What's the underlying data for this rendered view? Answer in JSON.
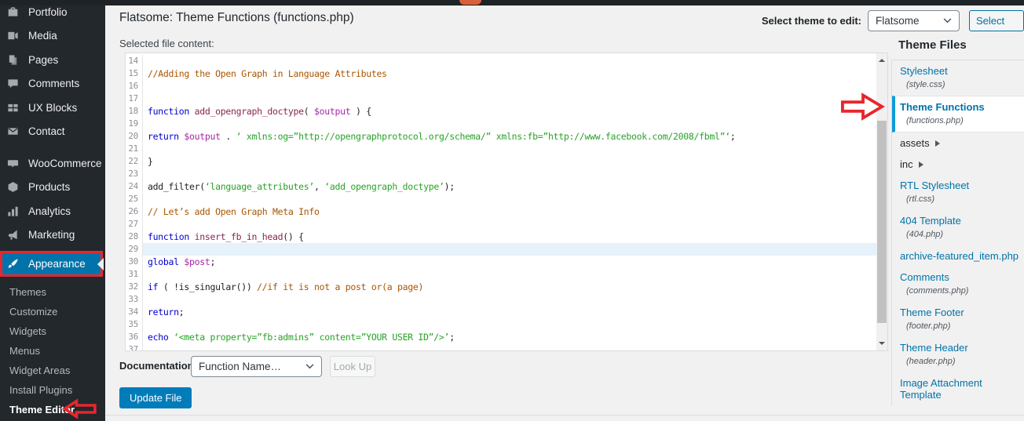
{
  "admin_bar": {
    "badge_color": "#d8613c"
  },
  "sidebar": {
    "items": [
      {
        "label": "Portfolio",
        "icon": "portfolio-icon"
      },
      {
        "label": "Media",
        "icon": "media-icon"
      },
      {
        "label": "Pages",
        "icon": "pages-icon"
      },
      {
        "label": "Comments",
        "icon": "comments-icon"
      },
      {
        "label": "UX Blocks",
        "icon": "ux-blocks-icon"
      },
      {
        "label": "Contact",
        "icon": "contact-icon",
        "separator_after": true
      },
      {
        "label": "WooCommerce",
        "icon": "woocommerce-icon"
      },
      {
        "label": "Products",
        "icon": "products-icon"
      },
      {
        "label": "Analytics",
        "icon": "analytics-icon"
      },
      {
        "label": "Marketing",
        "icon": "marketing-icon"
      }
    ],
    "appearance": {
      "label": "Appearance",
      "icon": "appearance-icon",
      "active": true,
      "annotated": true
    },
    "submenu": [
      {
        "label": "Themes"
      },
      {
        "label": "Customize"
      },
      {
        "label": "Widgets"
      },
      {
        "label": "Menus"
      },
      {
        "label": "Widget Areas"
      },
      {
        "label": "Install Plugins"
      },
      {
        "label": "Theme Editor",
        "active": true,
        "annotated": true
      }
    ]
  },
  "header": {
    "title": "Flatsome: Theme Functions (functions.php)",
    "select_theme_label": "Select theme to edit:",
    "theme_select_value": "Flatsome",
    "select_button_label": "Select"
  },
  "editor": {
    "label": "Selected file content:",
    "active_line": 29,
    "lines": [
      {
        "n": 14,
        "seg": []
      },
      {
        "n": 15,
        "seg": [
          [
            "com",
            "//Adding the Open Graph in Language Attributes"
          ]
        ]
      },
      {
        "n": 16,
        "seg": []
      },
      {
        "n": 17,
        "seg": []
      },
      {
        "n": 18,
        "seg": [
          [
            "kw",
            "function"
          ],
          [
            "pl",
            " "
          ],
          [
            "def",
            "add_opengraph_doctype"
          ],
          [
            "pl",
            "( "
          ],
          [
            "var",
            "$output"
          ],
          [
            "pl",
            " ) {"
          ]
        ]
      },
      {
        "n": 19,
        "seg": []
      },
      {
        "n": 20,
        "seg": [
          [
            "kw",
            "return"
          ],
          [
            "pl",
            " "
          ],
          [
            "var",
            "$output"
          ],
          [
            "pl",
            " . "
          ],
          [
            "str",
            "‘ xmlns:og=”http://opengraphprotocol.org/schema/” xmlns:fb=”http://www.facebook.com/2008/fbml”‘"
          ],
          [
            "pl",
            ";"
          ]
        ]
      },
      {
        "n": 21,
        "seg": []
      },
      {
        "n": 22,
        "seg": [
          [
            "pl",
            "}"
          ]
        ]
      },
      {
        "n": 23,
        "seg": []
      },
      {
        "n": 24,
        "seg": [
          [
            "pl",
            "add_filter("
          ],
          [
            "str",
            "‘language_attributes’"
          ],
          [
            "pl",
            ", "
          ],
          [
            "str",
            "‘add_opengraph_doctype’"
          ],
          [
            "pl",
            ");"
          ]
        ]
      },
      {
        "n": 25,
        "seg": []
      },
      {
        "n": 26,
        "seg": [
          [
            "com",
            "// Let’s add Open Graph Meta Info"
          ]
        ]
      },
      {
        "n": 27,
        "seg": []
      },
      {
        "n": 28,
        "seg": [
          [
            "kw",
            "function"
          ],
          [
            "pl",
            " "
          ],
          [
            "def",
            "insert_fb_in_head"
          ],
          [
            "pl",
            "() {"
          ]
        ]
      },
      {
        "n": 29,
        "seg": []
      },
      {
        "n": 30,
        "seg": [
          [
            "kw",
            "global"
          ],
          [
            "pl",
            " "
          ],
          [
            "var",
            "$post"
          ],
          [
            "pl",
            ";"
          ]
        ]
      },
      {
        "n": 31,
        "seg": []
      },
      {
        "n": 32,
        "seg": [
          [
            "kw",
            "if"
          ],
          [
            "pl",
            " ( !is_singular()) "
          ],
          [
            "com",
            "//if it is not a post or(a page)"
          ]
        ]
      },
      {
        "n": 33,
        "seg": []
      },
      {
        "n": 34,
        "seg": [
          [
            "kw",
            "return"
          ],
          [
            "pl",
            ";"
          ]
        ]
      },
      {
        "n": 35,
        "seg": []
      },
      {
        "n": 36,
        "seg": [
          [
            "kw",
            "echo"
          ],
          [
            "pl",
            " "
          ],
          [
            "str",
            "‘<meta property=”fb:admins” content=”YOUR USER ID”/>’"
          ],
          [
            "pl",
            ";"
          ]
        ]
      },
      {
        "n": 37,
        "seg": []
      }
    ]
  },
  "theme_files": {
    "heading": "Theme Files",
    "files": [
      {
        "label": "Stylesheet",
        "file": "(style.css)",
        "kind": "link"
      },
      {
        "label": "Theme Functions",
        "file": "(functions.php)",
        "kind": "active",
        "annotated": true
      },
      {
        "label": "assets",
        "kind": "folder"
      },
      {
        "label": "inc",
        "kind": "folder"
      },
      {
        "label": "RTL Stylesheet",
        "file": "(rtl.css)",
        "kind": "link"
      },
      {
        "label": "404 Template",
        "file": "(404.php)",
        "kind": "link"
      },
      {
        "label": "archive-featured_item.php",
        "kind": "link"
      },
      {
        "label": "Comments",
        "file": "(comments.php)",
        "kind": "link"
      },
      {
        "label": "Theme Footer",
        "file": "(footer.php)",
        "kind": "link"
      },
      {
        "label": "Theme Header",
        "file": "(header.php)",
        "kind": "link"
      },
      {
        "label": "Image Attachment Template",
        "kind": "link"
      }
    ]
  },
  "footer": {
    "documentation_label": "Documentation:",
    "doc_select_value": "Function Name…",
    "lookup_label": "Look Up",
    "update_label": "Update File"
  },
  "colors": {
    "accent_blue": "#0073aa",
    "primary_button": "#007cba",
    "annotation_red": "#e8262d",
    "active_line": "#e5f1fb",
    "sidebar_bg": "#23282d",
    "page_bg": "#f1f1f1"
  }
}
